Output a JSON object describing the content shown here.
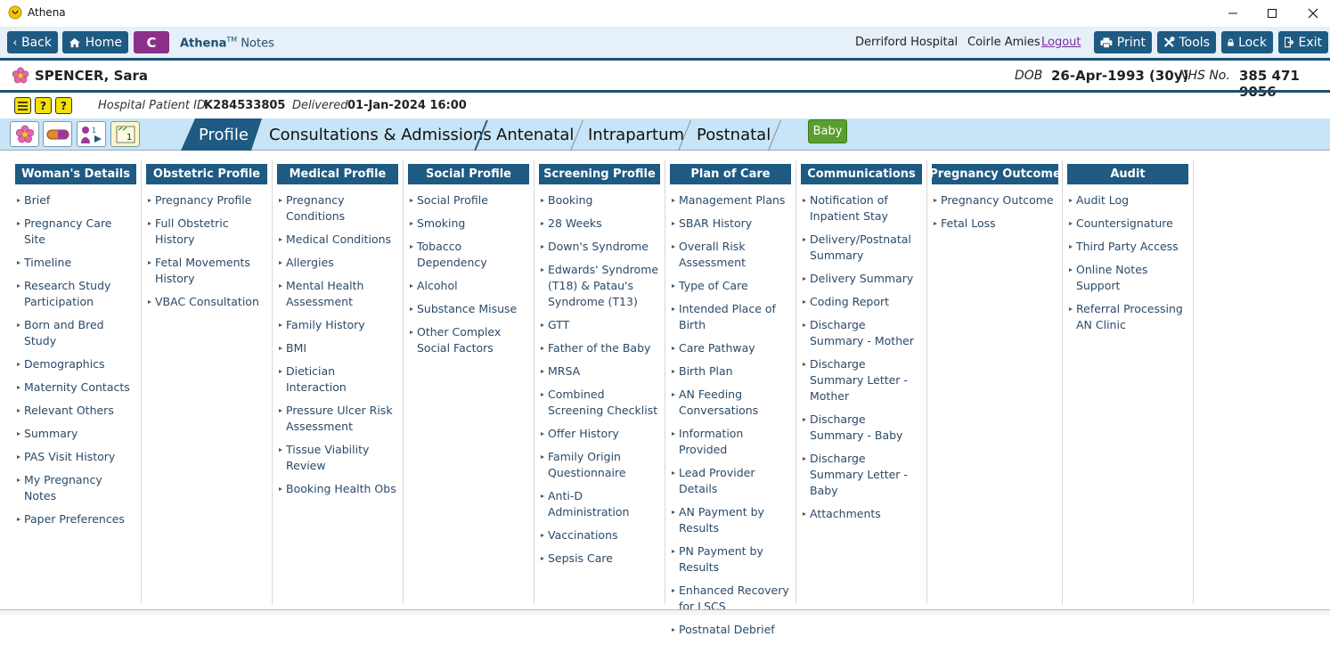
{
  "window": {
    "title": "Athena"
  },
  "toolbar": {
    "back": "Back",
    "home": "Home",
    "c_button": "C",
    "brand_name": "Athena",
    "brand_tm": "TM",
    "brand_suffix": "Notes",
    "hospital": "Derriford Hospital",
    "user": "Coirle Amies",
    "logout": "Logout",
    "print": "Print",
    "tools": "Tools",
    "lock": "Lock",
    "exit": "Exit"
  },
  "patient": {
    "name": "SPENCER, Sara",
    "dob_label": "DOB",
    "dob": "26-Apr-1993 (30y)",
    "nhs_label": "NHS No.",
    "nhs": "385 471 9056",
    "hospital_id_label": "Hospital Patient ID",
    "hospital_id": "K284533805",
    "delivered_label": "Delivered",
    "delivered": "01-Jan-2024 16:00"
  },
  "tabs": {
    "profile": "Profile",
    "consultations": "Consultations & Admissions",
    "antenatal": "Antenatal",
    "intrapartum": "Intrapartum",
    "postnatal": "Postnatal",
    "baby": "Baby",
    "icon4_number": "1"
  },
  "columns": [
    {
      "title": "Woman's Details",
      "items": [
        "Brief",
        "Pregnancy Care Site",
        "Timeline",
        "Research Study Participation",
        "Born and Bred Study",
        "Demographics",
        "Maternity Contacts",
        "Relevant Others",
        "Summary",
        "PAS Visit History",
        "My Pregnancy Notes",
        "Paper Preferences"
      ]
    },
    {
      "title": "Obstetric Profile",
      "items": [
        "Pregnancy Profile",
        "Full Obstetric History",
        "Fetal Movements History",
        "VBAC Consultation"
      ]
    },
    {
      "title": "Medical Profile",
      "items": [
        "Pregnancy Conditions",
        "Medical Conditions",
        "Allergies",
        "Mental Health Assessment",
        "Family History",
        "BMI",
        "Dietician Interaction",
        "Pressure Ulcer Risk Assessment",
        "Tissue Viability Review",
        "Booking Health Obs"
      ]
    },
    {
      "title": "Social Profile",
      "items": [
        "Social Profile",
        "Smoking",
        "Tobacco Dependency",
        "Alcohol",
        "Substance Misuse",
        "Other Complex Social Factors"
      ]
    },
    {
      "title": "Screening Profile",
      "items": [
        "Booking",
        "28 Weeks",
        "Down's Syndrome",
        "Edwards' Syndrome (T18) & Patau's Syndrome (T13)",
        "GTT",
        "Father of the Baby",
        "MRSA",
        "Combined Screening Checklist",
        "Offer History",
        "Family Origin Questionnaire",
        "Anti-D Administration",
        "Vaccinations",
        "Sepsis Care"
      ]
    },
    {
      "title": "Plan of Care",
      "items": [
        "Management Plans",
        "SBAR History",
        "Overall Risk Assessment",
        "Type of Care",
        "Intended Place of Birth",
        "Care Pathway",
        "Birth Plan",
        "AN Feeding Conversations",
        "Information Provided",
        "Lead Provider Details",
        "AN Payment by Results",
        "PN Payment by Results",
        "Enhanced Recovery for LSCS",
        "Postnatal Debrief"
      ]
    },
    {
      "title": "Communications",
      "items": [
        "Notification of Inpatient Stay",
        "Delivery/Postnatal Summary",
        "Delivery Summary",
        "Coding Report",
        "Discharge Summary - Mother",
        "Discharge Summary Letter - Mother",
        "Discharge Summary - Baby",
        "Discharge Summary Letter - Baby",
        "Attachments"
      ]
    },
    {
      "title": "Pregnancy Outcome",
      "items": [
        "Pregnancy Outcome",
        "Fetal Loss"
      ]
    },
    {
      "title": "Audit",
      "items": [
        "Audit Log",
        "Countersignature",
        "Third Party Access",
        "Online Notes Support",
        "Referral Processing AN Clinic"
      ]
    }
  ],
  "colors": {
    "primary": "#1e5a82",
    "c_button": "#8b2f8b",
    "baby": "#5a9e2e",
    "tab_bar": "#c7e5f6"
  }
}
